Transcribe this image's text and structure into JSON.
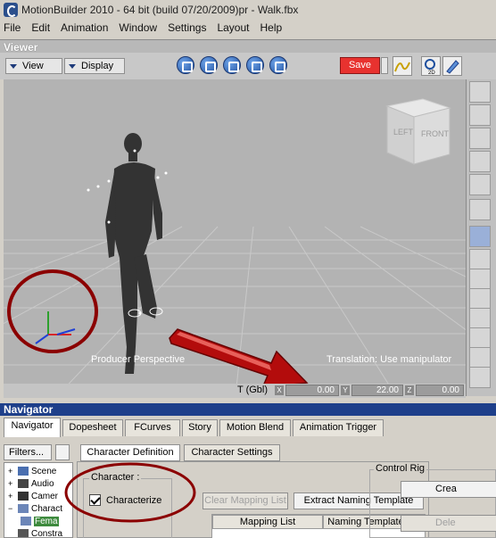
{
  "window": {
    "title": "MotionBuilder 2010  -  64 bit (build 07/20/2009)pr  -  Walk.fbx"
  },
  "menu": [
    "File",
    "Edit",
    "Animation",
    "Window",
    "Settings",
    "Layout",
    "Help"
  ],
  "viewer": {
    "header": "Viewer",
    "view_menu": "View",
    "display_menu": "Display",
    "save_label": "Save",
    "camera_label": "Producer Perspective",
    "manipulator_label": "Translation: Use manipulator",
    "viewcube": {
      "left": "LEFT",
      "front": "FRONT"
    }
  },
  "status": {
    "transform_label": "T (Gbl)",
    "x_label": "X",
    "x_value": "0.00",
    "y_label": "Y",
    "y_value": "22.00",
    "z_label": "Z",
    "z_value": "0.00"
  },
  "navigator": {
    "header": "Navigator",
    "tabs": [
      "Navigator",
      "Dopesheet",
      "FCurves",
      "Story",
      "Motion Blend",
      "Animation Trigger"
    ],
    "filters_label": "Filters...",
    "tree": [
      {
        "label": "Scene",
        "expander": "+"
      },
      {
        "label": "Audio",
        "expander": "+"
      },
      {
        "label": "Camer",
        "expander": "+"
      },
      {
        "label": "Charact",
        "expander": "−"
      },
      {
        "label": "Fema",
        "expander": ""
      },
      {
        "label": "Constra",
        "expander": ""
      }
    ],
    "subtabs": [
      "Character Definition",
      "Character Settings"
    ],
    "character_group": "Character :",
    "characterize_label": "Characterize",
    "clear_mapping_label": "Clear Mapping List",
    "extract_template_label": "Extract Naming Template",
    "table_headers": [
      "Mapping List",
      "Naming Template"
    ],
    "control_rig_group": "Control Rig",
    "control_rig_buttons": [
      "Crea",
      "Dele"
    ]
  },
  "colors": {
    "save_button": "#e8322f",
    "navigator_header": "#1e3f8a",
    "annotation": "#8b0000"
  }
}
